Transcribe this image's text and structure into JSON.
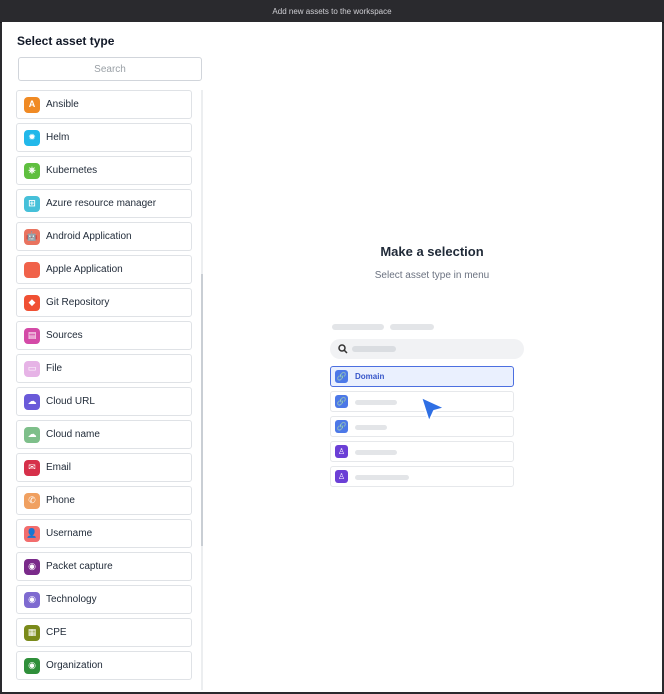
{
  "window": {
    "title": "Add new assets to the workspace"
  },
  "sidebar": {
    "title": "Select asset type",
    "search_placeholder": "Search",
    "items": [
      {
        "label": "Ansible",
        "icon": "ansible-icon",
        "color": "#f08a24",
        "glyph": "A"
      },
      {
        "label": "Helm",
        "icon": "helm-icon",
        "color": "#22b8ea",
        "glyph": "✹"
      },
      {
        "label": "Kubernetes",
        "icon": "kubernetes-icon",
        "color": "#5fbf3f",
        "glyph": "⎈"
      },
      {
        "label": "Azure resource manager",
        "icon": "windows-icon",
        "color": "#46c0d9",
        "glyph": "⊞"
      },
      {
        "label": "Android Application",
        "icon": "android-icon",
        "color": "#e9735f",
        "glyph": "🤖"
      },
      {
        "label": "Apple Application",
        "icon": "apple-icon",
        "color": "#f0624a",
        "glyph": ""
      },
      {
        "label": "Git Repository",
        "icon": "git-icon",
        "color": "#f05033",
        "glyph": "◆"
      },
      {
        "label": "Sources",
        "icon": "sources-icon",
        "color": "#d44aa7",
        "glyph": "▤"
      },
      {
        "label": "File",
        "icon": "file-icon",
        "color": "#e6b3e6",
        "glyph": "▭"
      },
      {
        "label": "Cloud URL",
        "icon": "cloud-url-icon",
        "color": "#6a5ad9",
        "glyph": "☁"
      },
      {
        "label": "Cloud name",
        "icon": "cloud-name-icon",
        "color": "#7ebf8a",
        "glyph": "☁"
      },
      {
        "label": "Email",
        "icon": "email-icon",
        "color": "#d6304a",
        "glyph": "✉"
      },
      {
        "label": "Phone",
        "icon": "phone-icon",
        "color": "#f0a060",
        "glyph": "✆"
      },
      {
        "label": "Username",
        "icon": "username-icon",
        "color": "#f26d6d",
        "glyph": "👤"
      },
      {
        "label": "Packet capture",
        "icon": "packet-capture-icon",
        "color": "#7a2a8a",
        "glyph": "◉"
      },
      {
        "label": "Technology",
        "icon": "technology-icon",
        "color": "#7e6ad0",
        "glyph": "◉"
      },
      {
        "label": "CPE",
        "icon": "cpe-icon",
        "color": "#7a8a1a",
        "glyph": "▦"
      },
      {
        "label": "Organization",
        "icon": "organization-icon",
        "color": "#2f8f3a",
        "glyph": "◉"
      }
    ]
  },
  "main": {
    "title": "Make a selection",
    "subtitle": "Select asset type in menu",
    "illustration": {
      "selected_label": "Domain",
      "icons": [
        "link-icon",
        "link-icon",
        "link-icon",
        "person-pin-icon",
        "person-pin-icon"
      ],
      "colors": {
        "blue": "#4c78e8",
        "purple": "#6b3fd6",
        "cursor": "#2f6fe4"
      }
    }
  }
}
